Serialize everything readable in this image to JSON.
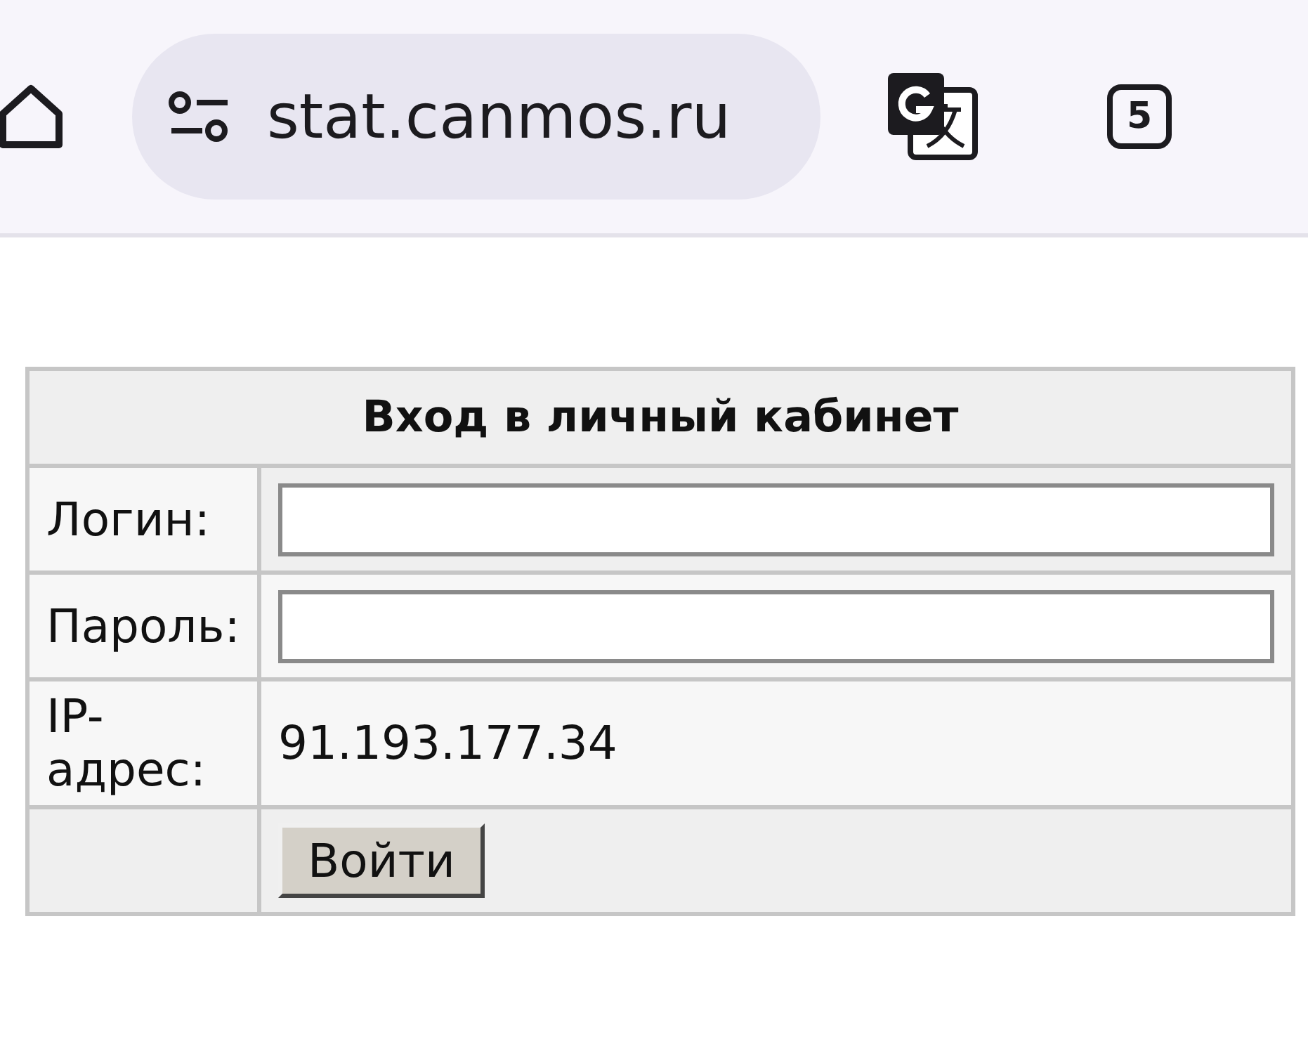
{
  "browser": {
    "url": "stat.canmos.ru",
    "tab_count": "5"
  },
  "form": {
    "title": "Вход в личный кабинет",
    "rows": [
      {
        "kind": "input",
        "label": "Логин:"
      },
      {
        "kind": "password",
        "label": "Пароль:"
      },
      {
        "kind": "text",
        "label": "IP-адрес:",
        "value": "91.193.177.34"
      },
      {
        "kind": "button",
        "button": "Войти"
      }
    ]
  }
}
